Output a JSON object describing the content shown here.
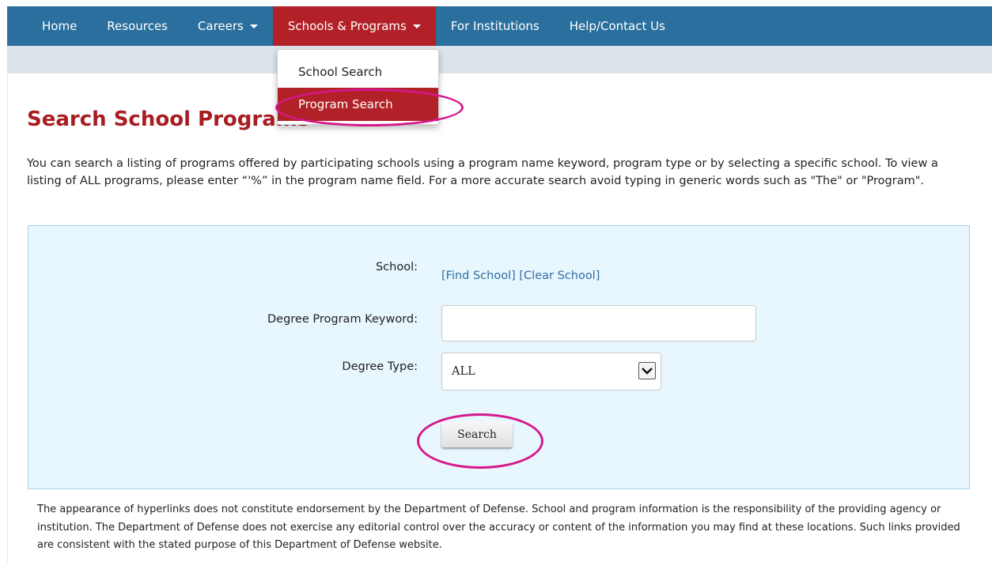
{
  "nav": {
    "home": "Home",
    "resources": "Resources",
    "careers": "Careers",
    "schools_programs": "Schools & Programs",
    "for_institutions": "For Institutions",
    "help_contact": "Help/Contact Us"
  },
  "dropdown": {
    "items": [
      "School Search",
      "Program Search"
    ]
  },
  "page": {
    "title": "Search School Programs",
    "intro": "You can search a listing of programs offered by participating schools using a program name keyword, program type or by selecting a specific school. To view a listing of ALL programs, please enter “'%” in the program name field. For a more accurate search avoid typing in generic words such as \"The\" or \"Program\"."
  },
  "form": {
    "school_label": "School:",
    "find_school": "[Find School]",
    "clear_school": "[Clear School]",
    "keyword_label": "Degree Program Keyword:",
    "keyword_value": "",
    "degree_type_label": "Degree Type:",
    "degree_type_value": "ALL",
    "search_button": "Search"
  },
  "disclaimer": "The appearance of hyperlinks does not constitute endorsement by the Department of Defense. School and program information is the responsibility of the providing agency or institution. The Department of Defense does not exercise any editorial control over the accuracy or content of the information you may find at these locations. Such links provided are consistent with the stated purpose of this Department of Defense website.",
  "colors": {
    "navbar": "#2a6f9d",
    "active": "#b22127",
    "title": "#a81c22",
    "link": "#2f6ea6",
    "highlight": "#d4188c",
    "panel": "#e8f6fd"
  }
}
